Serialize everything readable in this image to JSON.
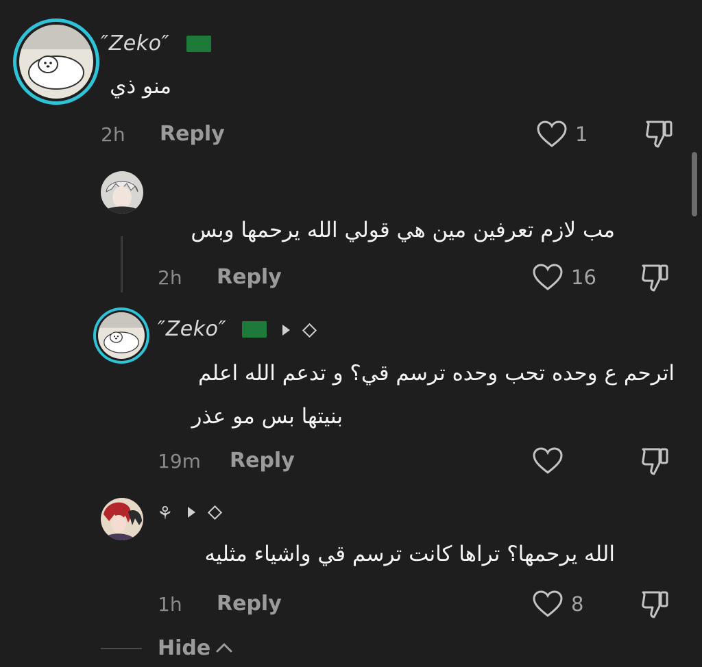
{
  "comments": [
    {
      "author": "″Zeko″",
      "text": "منو ذي",
      "time": "2h",
      "reply": "Reply",
      "likes": "1"
    },
    {
      "author": "",
      "text": "مب لازم تعرفين مين هي قولي الله يرحمها وبس",
      "time": "2h",
      "reply": "Reply",
      "likes": "16"
    },
    {
      "author": "″Zeko″",
      "text_line1": "اترحم ع وحده تحب وحده ترسم قي؟ و تدعم الله اعلم",
      "text_line2": "بنيتها بس مو عذر",
      "time": "19m",
      "reply": "Reply",
      "likes": ""
    },
    {
      "author": "⚘",
      "text": "الله يرحمها؟ تراها كانت ترسم قي واشياء مثليه",
      "time": "1h",
      "reply": "Reply",
      "likes": "8"
    }
  ],
  "hide_label": "Hide",
  "icons": {
    "like": "heart-outline-icon",
    "dislike": "thumbs-down-icon",
    "flag": "saudi-flag-icon",
    "badge": "play-triangle-icon",
    "diamond": "diamond-outline-icon",
    "chevron": "chevron-up-icon"
  },
  "colors": {
    "background": "#1e1e1e",
    "ring": "#2fc3d8",
    "flag": "#1d7a3a"
  }
}
